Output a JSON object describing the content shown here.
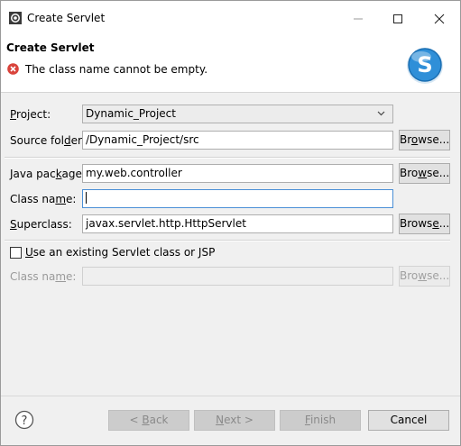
{
  "window": {
    "title": "Create Servlet",
    "controls": {
      "minimize": "—",
      "maximize": "☐",
      "close": "✕"
    }
  },
  "banner": {
    "title": "Create Servlet",
    "message": "The class name cannot be empty."
  },
  "form": {
    "project": {
      "label": "Project:",
      "value": "Dynamic_Project"
    },
    "source_folder": {
      "label": "Source folder:",
      "value": "/Dynamic_Project/src",
      "button": "Browse..."
    },
    "java_package": {
      "label": "Java package:",
      "value": "my.web.controller",
      "button": "Browse..."
    },
    "class_name": {
      "label": "Class name:",
      "value": ""
    },
    "superclass": {
      "label": "Superclass:",
      "value": "javax.servlet.http.HttpServlet",
      "button": "Browse..."
    },
    "use_existing": {
      "label": "Use an existing Servlet class or JSP",
      "checked": false
    },
    "existing_class_name": {
      "label": "Class name:",
      "value": "",
      "button": "Browse..."
    }
  },
  "footer": {
    "back": "< Back",
    "next": "Next >",
    "finish": "Finish",
    "cancel": "Cancel"
  },
  "icons": {
    "app": "eclipse-gear-icon",
    "error": "error-x-icon",
    "logo": "servlet-s-logo-icon",
    "help": "help-question-icon"
  },
  "colors": {
    "error_red": "#d9433b",
    "logo_blue": "#2f8fd8",
    "focus_border": "#4a8fd6"
  }
}
